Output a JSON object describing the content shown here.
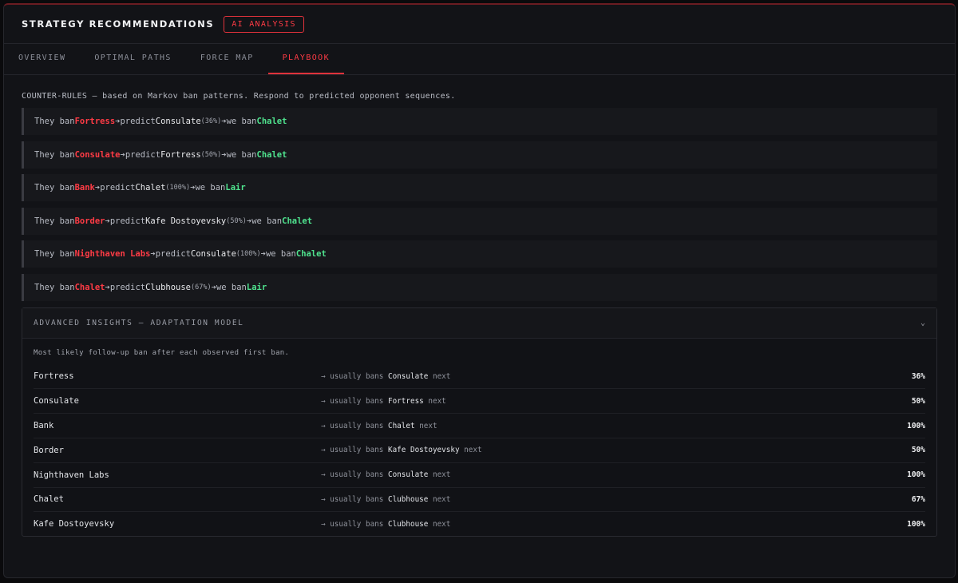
{
  "header": {
    "title": "STRATEGY RECOMMENDATIONS",
    "badge": "AI ANALYSIS"
  },
  "tabs": [
    {
      "label": "OVERVIEW",
      "active": false
    },
    {
      "label": "OPTIMAL PATHS",
      "active": false
    },
    {
      "label": "FORCE MAP",
      "active": false
    },
    {
      "label": "PLAYBOOK",
      "active": true
    }
  ],
  "intro": "COUNTER-RULES — based on Markov ban patterns. Respond to predicted opponent sequences.",
  "rule_words": {
    "they_ban": "They ban",
    "predict": "predict",
    "we_ban": "we ban",
    "arrow": "➔"
  },
  "rules": [
    {
      "they": "Fortress",
      "predict": "Consulate",
      "pct": "(36%)",
      "we": "Chalet"
    },
    {
      "they": "Consulate",
      "predict": "Fortress",
      "pct": "(50%)",
      "we": "Chalet"
    },
    {
      "they": "Bank",
      "predict": "Chalet",
      "pct": "(100%)",
      "we": "Lair"
    },
    {
      "they": "Border",
      "predict": "Kafe Dostoyevsky",
      "pct": "(50%)",
      "we": "Chalet"
    },
    {
      "they": "Nighthaven Labs",
      "predict": "Consulate",
      "pct": "(100%)",
      "we": "Chalet"
    },
    {
      "they": "Chalet",
      "predict": "Clubhouse",
      "pct": "(67%)",
      "we": "Lair"
    }
  ],
  "insights": {
    "title": "ADVANCED INSIGHTS — ADAPTATION MODEL",
    "chevron": "⌄",
    "description": "Most likely follow-up ban after each observed first ban.",
    "prefix": "→ usually bans",
    "suffix": "next",
    "rows": [
      {
        "map": "Fortress",
        "next": "Consulate",
        "pct": "36%"
      },
      {
        "map": "Consulate",
        "next": "Fortress",
        "pct": "50%"
      },
      {
        "map": "Bank",
        "next": "Chalet",
        "pct": "100%"
      },
      {
        "map": "Border",
        "next": "Kafe Dostoyevsky",
        "pct": "50%"
      },
      {
        "map": "Nighthaven Labs",
        "next": "Consulate",
        "pct": "100%"
      },
      {
        "map": "Chalet",
        "next": "Clubhouse",
        "pct": "67%"
      },
      {
        "map": "Kafe Dostoyevsky",
        "next": "Clubhouse",
        "pct": "100%"
      }
    ]
  }
}
